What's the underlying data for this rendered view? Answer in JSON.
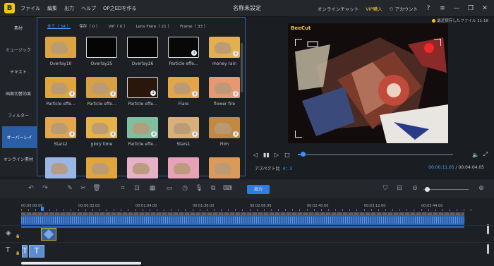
{
  "titlebar": {
    "logo_text": "B",
    "menu": [
      "ファイル",
      "編集",
      "出力",
      "ヘルプ",
      "OP之EDを作る"
    ],
    "window_title": "名称未設定",
    "online_chat": "オンラインチャット",
    "vip_label": "VIP購入",
    "account_label": "アカウント",
    "controls": {
      "help": "?",
      "menu": "≡",
      "minimize": "—",
      "restore": "❐",
      "close": "✕"
    }
  },
  "left_tabs": [
    {
      "label": "素材",
      "active": false
    },
    {
      "label": "ミュージック",
      "active": false
    },
    {
      "label": "テキスト",
      "active": false
    },
    {
      "label": "画面切替効果",
      "active": false
    },
    {
      "label": "フィルター",
      "active": false
    },
    {
      "label": "オーバーレイ",
      "active": true
    },
    {
      "label": "オンライン素材",
      "active": false
    }
  ],
  "library": {
    "subtabs": [
      {
        "label": "全て（ 34 ）",
        "active": true
      },
      {
        "label": "保存（ 0 ）",
        "active": false
      },
      {
        "label": "VIP（ 0 ）",
        "active": false
      },
      {
        "label": "Lens Flare（ 21 ）",
        "active": false
      },
      {
        "label": "Frame（ 33 ）",
        "active": false
      }
    ],
    "items": [
      {
        "label": "Overlay10",
        "bg": "#d9a441",
        "download": false,
        "cat": true
      },
      {
        "label": "Overlay25",
        "bg": "#050505",
        "download": false,
        "cat": false
      },
      {
        "label": "Overlay26",
        "bg": "#050505",
        "download": false,
        "cat": false
      },
      {
        "label": "Particle effe...",
        "bg": "#080808",
        "download": true,
        "cat": false
      },
      {
        "label": "money rain",
        "bg": "#e2b04e",
        "download": true,
        "cat": true
      },
      {
        "label": "Particle effe...",
        "bg": "#e0a53c",
        "download": true,
        "cat": true
      },
      {
        "label": "Particle effe...",
        "bg": "#d7a045",
        "download": true,
        "cat": true
      },
      {
        "label": "Particle effe...",
        "bg": "#2a170b",
        "download": true,
        "cat": false
      },
      {
        "label": "Flare",
        "bg": "#e2a54a",
        "download": true,
        "cat": true
      },
      {
        "label": "flower fire",
        "bg": "#e79870",
        "download": true,
        "cat": true
      },
      {
        "label": "Stars2",
        "bg": "#e3a64c",
        "download": true,
        "cat": true
      },
      {
        "label": "glory time",
        "bg": "#e6b24a",
        "download": true,
        "cat": true
      },
      {
        "label": "Particle effe...",
        "bg": "#7fbfa0",
        "download": true,
        "cat": true
      },
      {
        "label": "Stars1",
        "bg": "#d9b07a",
        "download": true,
        "cat": true
      },
      {
        "label": "Film",
        "bg": "#c28a40",
        "download": true,
        "cat": true
      },
      {
        "label": "",
        "bg": "#9ab6e6",
        "download": false,
        "cat": true
      },
      {
        "label": "",
        "bg": "#e0a53c",
        "download": false,
        "cat": true
      },
      {
        "label": "",
        "bg": "#e6b0c8",
        "download": false,
        "cat": true
      },
      {
        "label": "",
        "bg": "#e8a2b8",
        "download": false,
        "cat": true
      },
      {
        "label": "",
        "bg": "#d99a5a",
        "download": false,
        "cat": true
      }
    ]
  },
  "preview": {
    "saved_text": "最近保存したファイル 11:18",
    "brand": "BeeCut",
    "controls": {
      "prev": "◁",
      "play_pause": "▮▮",
      "next": "▷",
      "stop": "□",
      "volume": "🔈",
      "fullscreen": "⤢"
    },
    "seek_progress": 0.03,
    "aspect_label": "アスペクト比",
    "aspect_value": "4：3",
    "current_time": "00:00:11.05",
    "separator": "/",
    "total_time": "00:04:04.05"
  },
  "toolbar": {
    "icons": [
      {
        "name": "undo-icon",
        "glyph": "↶"
      },
      {
        "name": "redo-icon",
        "glyph": "↷"
      },
      {
        "name": "edit-icon",
        "glyph": "✎"
      },
      {
        "name": "cut-icon",
        "glyph": "✂"
      },
      {
        "name": "delete-icon",
        "glyph": "🗑"
      },
      {
        "name": "crop-icon",
        "glyph": "⌗"
      },
      {
        "name": "zoom-icon",
        "glyph": "⊡"
      },
      {
        "name": "mosaic-icon",
        "glyph": "▦"
      },
      {
        "name": "freeze-icon",
        "glyph": "▭"
      },
      {
        "name": "duration-icon",
        "glyph": "◷"
      },
      {
        "name": "record-icon",
        "glyph": "🎙"
      },
      {
        "name": "pip-icon",
        "glyph": "⧉"
      },
      {
        "name": "subtitle-icon",
        "glyph": "⌨"
      }
    ],
    "export_label": "出力",
    "zoom_level": 0.05
  },
  "timeline": {
    "ticks": [
      "00:00:00.00",
      "00:00:32.00",
      "00:01:04.00",
      "00:01:36.00",
      "00:02:08.00",
      "00:02:40.00",
      "00:03:12.00",
      "00:03:44.00"
    ],
    "overlay_track_icon": "◈",
    "text_track_icon": "T",
    "text_clip_labels": [
      "T",
      "T"
    ]
  }
}
